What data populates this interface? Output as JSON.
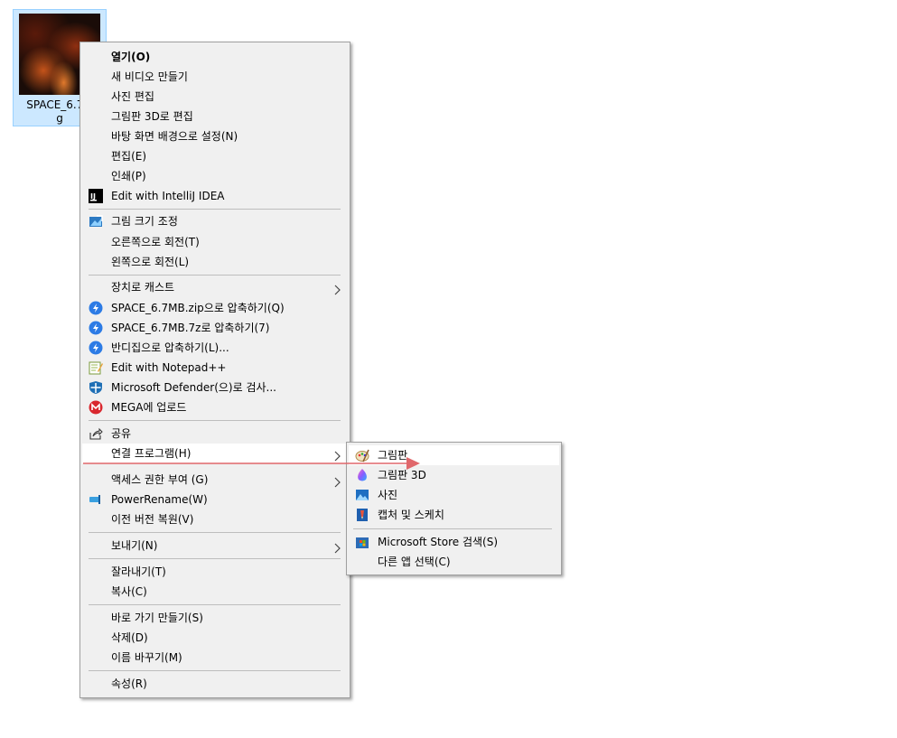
{
  "file": {
    "name": "SPACE_6.7MB.jpg",
    "label_line1": "SPACE_6.7M",
    "label_line2": "g"
  },
  "context_menu": {
    "open": "열기(O)",
    "new_video": "새 비디오 만들기",
    "edit_photo": "사진 편집",
    "paint3d_edit": "그림판 3D로 편집",
    "set_wallpaper": "바탕 화면 배경으로 설정(N)",
    "edit": "편집(E)",
    "print": "인쇄(P)",
    "intellij": "Edit with IntelliJ IDEA",
    "resize": "그림 크기 조정",
    "rotate_right": "오른쪽으로 회전(T)",
    "rotate_left": "왼쪽으로 회전(L)",
    "cast": "장치로 캐스트",
    "zip": "SPACE_6.7MB.zip으로 압축하기(Q)",
    "sevenz": "SPACE_6.7MB.7z로 압축하기(7)",
    "bandizip": "반디집으로 압축하기(L)...",
    "notepadpp": "Edit with Notepad++",
    "defender": "Microsoft Defender(으)로 검사...",
    "mega": "MEGA에 업로드",
    "share": "공유",
    "open_with": "연결 프로그램(H)",
    "access": "액세스 권한 부여 (G)",
    "powerrename": "PowerRename(W)",
    "restore": "이전 버전 복원(V)",
    "send_to": "보내기(N)",
    "cut": "잘라내기(T)",
    "copy": "복사(C)",
    "shortcut": "바로 가기 만들기(S)",
    "delete": "삭제(D)",
    "rename": "이름 바꾸기(M)",
    "properties": "속성(R)"
  },
  "open_with_submenu": {
    "paint": "그림판",
    "paint3d": "그림판 3D",
    "photos": "사진",
    "snip": "캡처 및 스케치",
    "store": "Microsoft Store 검색(S)",
    "other": "다른 앱 선택(C)"
  },
  "colors": {
    "accent_arrow": "#e0676b",
    "highlight": "#ffffff",
    "menu_bg": "#f0f0f0"
  }
}
